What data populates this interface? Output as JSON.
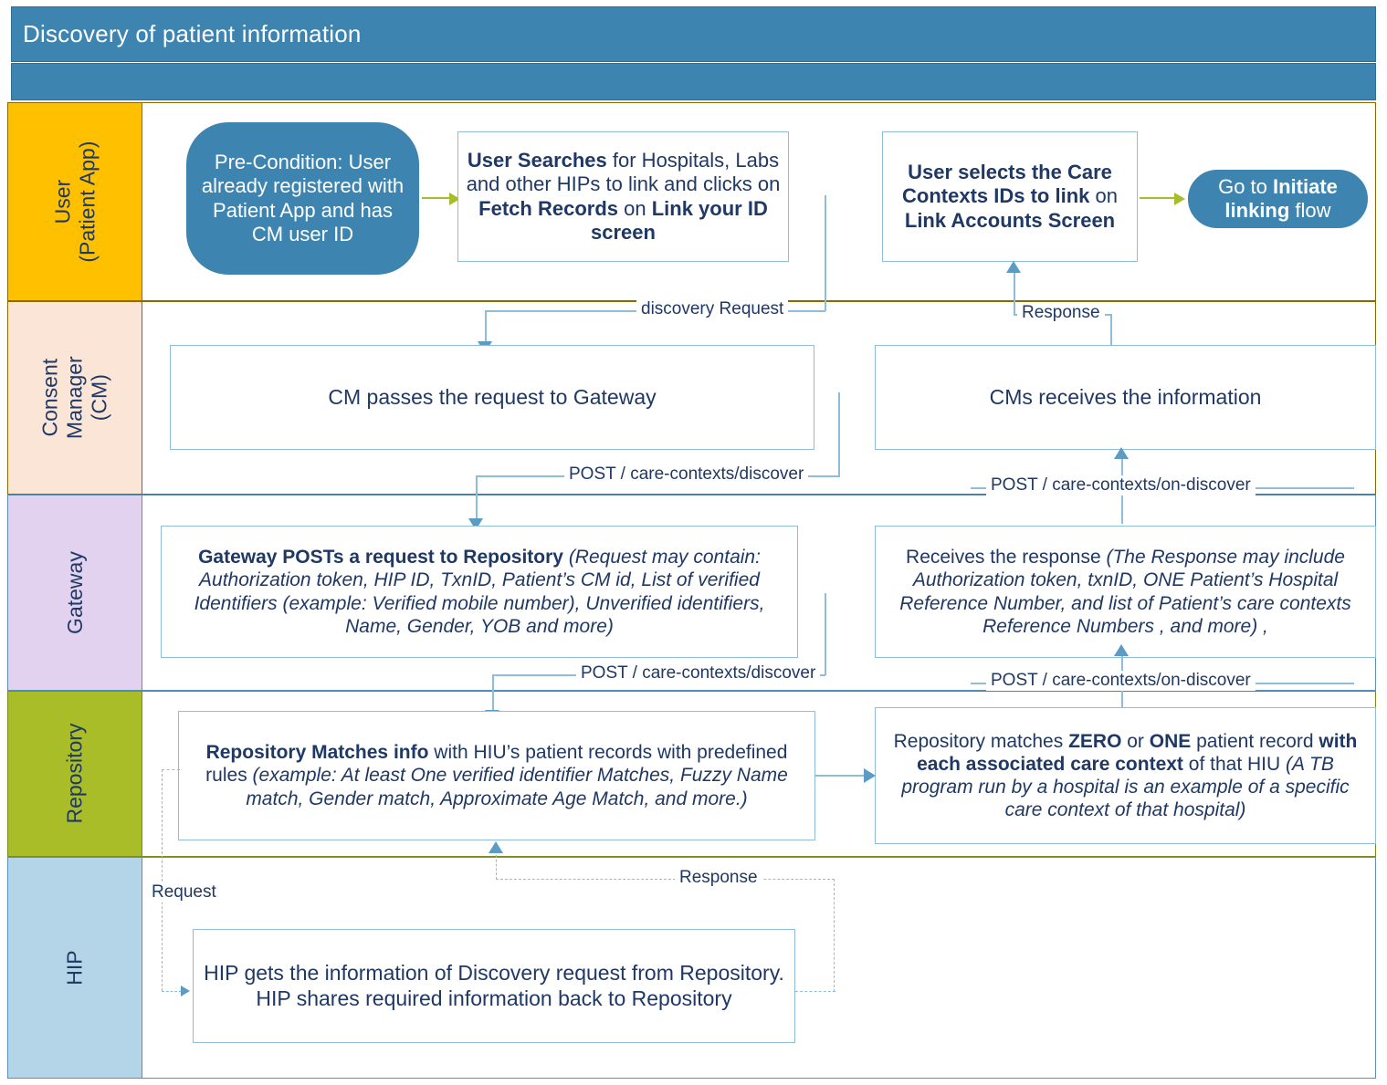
{
  "header": {
    "title": "Discovery of patient information"
  },
  "lanes": [
    {
      "id": "user",
      "label": "User\n(Patient App)"
    },
    {
      "id": "cm",
      "label": "Consent\nManager (CM)"
    },
    {
      "id": "gateway",
      "label": "Gateway"
    },
    {
      "id": "repo",
      "label": "Repository"
    },
    {
      "id": "hip",
      "label": "HIP"
    }
  ],
  "nodes": {
    "precondition": "Pre-Condition: User already registered with Patient App and has CM user ID",
    "user_searches": {
      "p1_b": "User Searches",
      "p2": " for Hospitals, Labs and other HIPs to link and clicks on ",
      "p3_b": "Fetch Records",
      "p4": " on ",
      "p5_b": "Link your ID screen"
    },
    "user_selects": {
      "p1_b": "User selects the Care Contexts IDs to link",
      "p2": " on ",
      "p3_b": "Link Accounts Screen"
    },
    "goto_linking": {
      "p1": "Go to ",
      "p2_b": "Initiate linking",
      "p3": " flow"
    },
    "cm_passes": "CM passes the request to Gateway",
    "cm_receives": "CMs receives the information",
    "gateway_posts": {
      "p1_b": "Gateway POSTs a request to Repository",
      "p2_i": " (Request may contain: Authorization token, HIP ID, TxnID, Patient’s CM id, List of verified Identifiers (example: Verified mobile number), Unverified identifiers, Name, Gender, YOB and more)"
    },
    "gateway_receives": {
      "p1": "Receives the response",
      "p2_i": " (The Response may include Authorization token, txnID, ONE Patient’s Hospital Reference Number, and list of Patient’s care contexts Reference Numbers , and more) ,"
    },
    "repo_matches_info": {
      "p1_b": "Repository Matches info",
      "p2": " with HIU’s patient records with predefined rules ",
      "p3_i": "(example: At least One verified identifier Matches, Fuzzy Name match, Gender match, Approximate Age Match,  and more.)"
    },
    "repo_matches_zero_one": {
      "p1": "Repository matches ",
      "p2_b": "ZERO",
      "p3": " or ",
      "p4_b": "ONE",
      "p5": " patient record ",
      "p6_b": "with each associated care context",
      "p7": " of that HIU ",
      "p8_i": "(A TB program run by a hospital is an example of a specific care context of that hospital)"
    },
    "hip_gets": "HIP gets the information of Discovery request from Repository. HIP shares required information back to Repository"
  },
  "connectors": {
    "discovery_request": "discovery Request",
    "response_top": "Response",
    "post_discover_cm": "POST / care-contexts/discover",
    "post_on_discover_cm": "POST / care-contexts/on-discover",
    "post_discover_gw": "POST / care-contexts/discover",
    "post_on_discover_gw": "POST / care-contexts/on-discover",
    "request_hip": "Request",
    "response_hip": "Response"
  }
}
